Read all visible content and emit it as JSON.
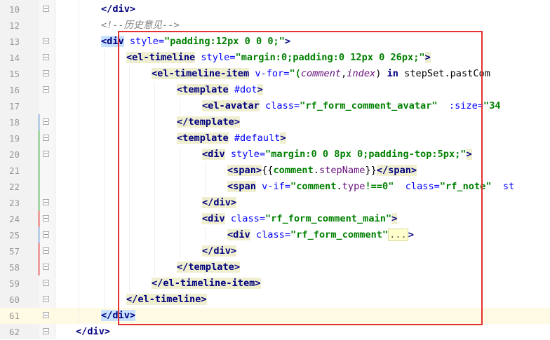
{
  "editor": {
    "lines": [
      {
        "num": "10",
        "indent": 2,
        "tokens": [
          {
            "t": "</div>",
            "c": "tag"
          }
        ],
        "fold": true
      },
      {
        "num": "12",
        "indent": 2,
        "tokens": [
          {
            "t": "<!--历史意见-->",
            "c": "comment"
          }
        ],
        "fold": false
      },
      {
        "num": "13",
        "indent": 2,
        "tokens": [
          {
            "t": "<div",
            "c": "tag tagbg-hl"
          },
          {
            "t": " style=",
            "c": "attr"
          },
          {
            "t": "\"padding:12px 0 0 0;\"",
            "c": "str"
          },
          {
            "t": ">",
            "c": "tag"
          }
        ],
        "fold": true
      },
      {
        "num": "14",
        "indent": 3,
        "tokens": [
          {
            "t": "<el-timeline",
            "c": "tag tagbg"
          },
          {
            "t": " style=",
            "c": "attr"
          },
          {
            "t": "\"margin:0;padding:0 12px 0 26px;\"",
            "c": "str"
          },
          {
            "t": ">",
            "c": "tag tagbg"
          }
        ],
        "fold": true
      },
      {
        "num": "15",
        "indent": 4,
        "tokens": [
          {
            "t": "<el-timeline-item",
            "c": "tag tagbg"
          },
          {
            "t": " v-for=",
            "c": "attr"
          },
          {
            "t": "\"(",
            "c": "str"
          },
          {
            "t": "comment",
            "c": "var"
          },
          {
            "t": ",",
            "c": "punct"
          },
          {
            "t": "index",
            "c": "var"
          },
          {
            "t": ") ",
            "c": "punct"
          },
          {
            "t": "in",
            "c": "kw"
          },
          {
            "t": " stepSet.pastCom",
            "c": "ident"
          }
        ],
        "fold": true
      },
      {
        "num": "16",
        "indent": 5,
        "tokens": [
          {
            "t": "<template",
            "c": "tag tagbg"
          },
          {
            "t": " #dot",
            "c": "attr"
          },
          {
            "t": ">",
            "c": "tag tagbg"
          }
        ],
        "fold": true
      },
      {
        "num": "17",
        "indent": 6,
        "tokens": [
          {
            "t": "<el-avatar",
            "c": "tag tagbg"
          },
          {
            "t": " class=",
            "c": "attr"
          },
          {
            "t": "\"rf_form_comment_avatar\"",
            "c": "str"
          },
          {
            "t": "  :size=",
            "c": "attr"
          },
          {
            "t": "\"34",
            "c": "str"
          }
        ],
        "fold": false
      },
      {
        "num": "18",
        "indent": 5,
        "tokens": [
          {
            "t": "</template>",
            "c": "tag tagbg"
          }
        ],
        "fold": true
      },
      {
        "num": "19",
        "indent": 5,
        "tokens": [
          {
            "t": "<template",
            "c": "tag tagbg"
          },
          {
            "t": " #default",
            "c": "attr"
          },
          {
            "t": ">",
            "c": "tag tagbg"
          }
        ],
        "fold": true
      },
      {
        "num": "20",
        "indent": 6,
        "tokens": [
          {
            "t": "<div",
            "c": "tag tagbg"
          },
          {
            "t": " style=",
            "c": "attr"
          },
          {
            "t": "\"margin:0 0 8px 0;padding-top:5px;\"",
            "c": "str"
          },
          {
            "t": ">",
            "c": "tag tagbg"
          }
        ],
        "fold": true
      },
      {
        "num": "21",
        "indent": 7,
        "tokens": [
          {
            "t": "<span>",
            "c": "tag tagbg"
          },
          {
            "t": "{{",
            "c": "punct"
          },
          {
            "t": "comment",
            "c": "str"
          },
          {
            "t": ".",
            "c": "punct"
          },
          {
            "t": "stepName",
            "c": "prop"
          },
          {
            "t": "}}",
            "c": "punct"
          },
          {
            "t": "</span>",
            "c": "tag tagbg"
          }
        ],
        "fold": false
      },
      {
        "num": "22",
        "indent": 7,
        "tokens": [
          {
            "t": "<span",
            "c": "tag tagbg"
          },
          {
            "t": " v-if=",
            "c": "attr"
          },
          {
            "t": "\"",
            "c": "str"
          },
          {
            "t": "comment",
            "c": "str"
          },
          {
            "t": ".",
            "c": "punct"
          },
          {
            "t": "type",
            "c": "prop"
          },
          {
            "t": "!==0\"",
            "c": "str"
          },
          {
            "t": "  class=",
            "c": "attr"
          },
          {
            "t": "\"rf_note\"",
            "c": "str"
          },
          {
            "t": "  st",
            "c": "attr"
          }
        ],
        "fold": false
      },
      {
        "num": "23",
        "indent": 6,
        "tokens": [
          {
            "t": "</div>",
            "c": "tag tagbg"
          }
        ],
        "fold": true
      },
      {
        "num": "24",
        "indent": 6,
        "tokens": [
          {
            "t": "<div",
            "c": "tag tagbg"
          },
          {
            "t": " class=",
            "c": "attr"
          },
          {
            "t": "\"rf_form_comment_main\"",
            "c": "str"
          },
          {
            "t": ">",
            "c": "tag tagbg"
          }
        ],
        "fold": true
      },
      {
        "num": "25",
        "indent": 7,
        "tokens": [
          {
            "t": "<div",
            "c": "tag tagbg"
          },
          {
            "t": " class=",
            "c": "attr"
          },
          {
            "t": "\"rf_form_comment\"",
            "c": "str"
          },
          {
            "t": "...",
            "c": "fold-placeholder"
          },
          {
            "t": ">",
            "c": "tag"
          }
        ],
        "fold": true
      },
      {
        "num": "57",
        "indent": 6,
        "tokens": [
          {
            "t": "</div>",
            "c": "tag tagbg"
          }
        ],
        "fold": true
      },
      {
        "num": "58",
        "indent": 5,
        "tokens": [
          {
            "t": "</template>",
            "c": "tag tagbg"
          }
        ],
        "fold": true
      },
      {
        "num": "59",
        "indent": 4,
        "tokens": [
          {
            "t": "</el-timeline-item>",
            "c": "tag tagbg"
          }
        ],
        "fold": true
      },
      {
        "num": "60",
        "indent": 3,
        "tokens": [
          {
            "t": "</el-timeline>",
            "c": "tag tagbg"
          }
        ],
        "fold": true
      },
      {
        "num": "61",
        "indent": 2,
        "tokens": [
          {
            "t": "</div>",
            "c": "tag tagbg-hl"
          }
        ],
        "fold": true,
        "current": true
      },
      {
        "num": "62",
        "indent": 1,
        "tokens": [
          {
            "t": "</div>",
            "c": "tag"
          }
        ],
        "fold": true
      }
    ]
  },
  "colors": {
    "highlight_box": "#e53030",
    "change_added": "#a6d6a6",
    "change_modified": "#b8cde8",
    "change_deleted": "#f0a0a0"
  }
}
